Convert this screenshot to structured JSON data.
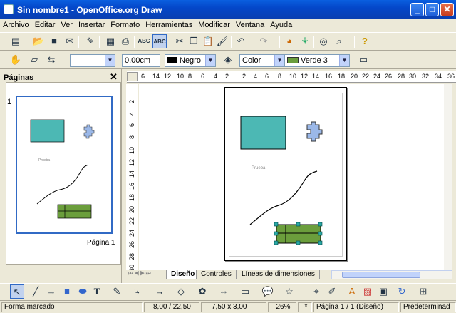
{
  "window": {
    "title": "Sin nombre1 - OpenOffice.org Draw"
  },
  "menu": [
    "Archivo",
    "Editar",
    "Ver",
    "Insertar",
    "Formato",
    "Herramientas",
    "Modificar",
    "Ventana",
    "Ayuda"
  ],
  "line_toolbar": {
    "line_width": "0,00cm",
    "line_color": "Negro",
    "area_style": "Color",
    "area_color": "Verde 3",
    "line_color_swatch": "#000000",
    "area_color_swatch": "#6b9e3c"
  },
  "pages_panel": {
    "title": "Páginas",
    "page_number": "1",
    "page_label": "Página 1",
    "sample_text": "Prueba"
  },
  "ruler": {
    "h_ticks": [
      "6",
      "14",
      "12",
      "10",
      "8",
      "6",
      "4",
      "2",
      "2",
      "4",
      "6",
      "8",
      "10",
      "12",
      "14",
      "16",
      "18",
      "20",
      "22",
      "24",
      "26",
      "28",
      "30",
      "32",
      "34",
      "36"
    ],
    "v_ticks": [
      "2",
      "4",
      "6",
      "8",
      "10",
      "12",
      "14",
      "16",
      "18",
      "20",
      "22",
      "24",
      "26",
      "28",
      "30"
    ]
  },
  "canvas": {
    "sample_text": "Prueba",
    "rect_color": "#4cb8b4",
    "green_color": "#6b9e3c"
  },
  "tabs": [
    "Diseño",
    "Controles",
    "Líneas de dimensiones"
  ],
  "status": {
    "mode": "Forma marcado",
    "position": "8,00 / 22,50",
    "size": "7,50 x 3,00",
    "zoom": "26%",
    "modified": "*",
    "page": "Página 1 / 1 (Diseño)",
    "style": "Predeterminad"
  }
}
